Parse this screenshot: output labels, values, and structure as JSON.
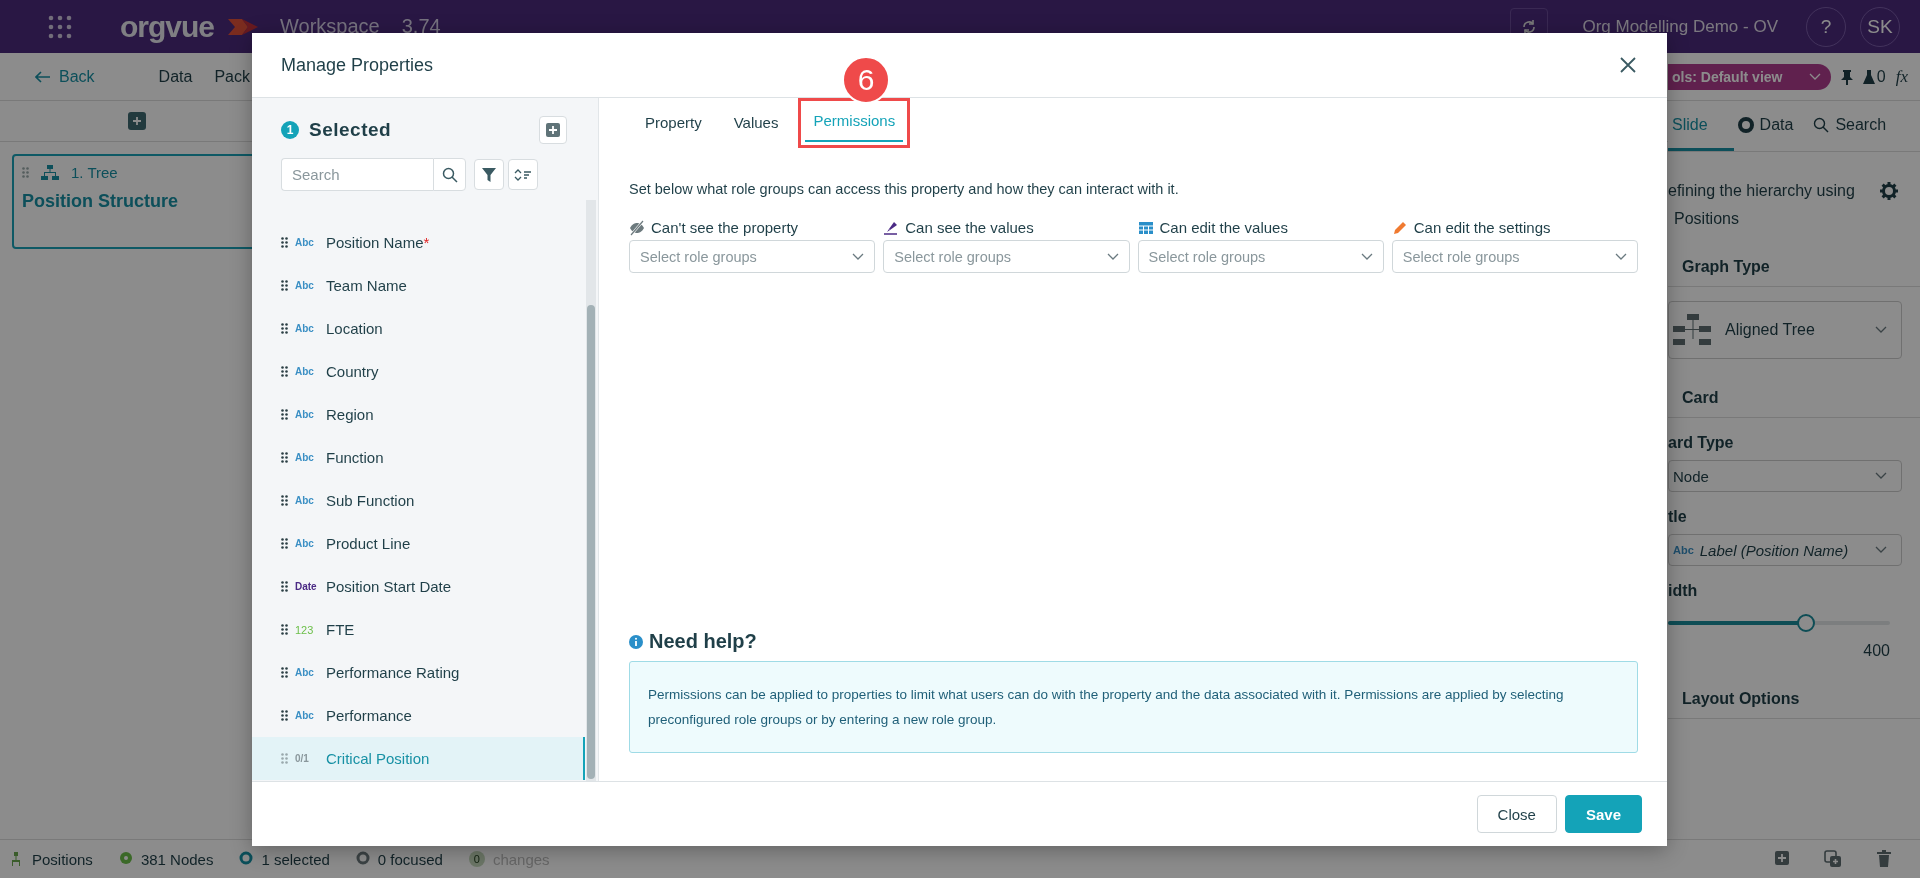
{
  "top_bar": {
    "app_name": "orgvue",
    "workspace": "Workspace",
    "version": "3.74",
    "project": "Org Modelling Demo - OV",
    "help": "?",
    "user_initials": "SK"
  },
  "toolbar": {
    "back": "Back",
    "menu": [
      "Data",
      "Pack"
    ],
    "view_pill": "ols: Default view",
    "flask_count": "0",
    "formula": "fx"
  },
  "canvas": {
    "card": {
      "kind_label": "1. Tree",
      "title": "Position Structure"
    }
  },
  "side_panel": {
    "tabs": [
      {
        "label": "Slide",
        "selected": true,
        "kind": "slide"
      },
      {
        "label": "Data",
        "selected": false,
        "kind": "data"
      },
      {
        "label": "Search",
        "selected": false,
        "kind": "search"
      }
    ],
    "description": "efining the hierarchy using",
    "hierarchy": "Positions",
    "graph_type_heading": "Graph Type",
    "graph_type": "Aligned Tree",
    "card_heading": "Card",
    "card_type_label": "ard Type",
    "card_type": "Node",
    "title_label": "tle",
    "title_tag": "Abc",
    "title_value": "Label (Position Name)",
    "width_label": "idth",
    "width_slider": {
      "level": 0.62
    },
    "width_max": "400",
    "layout_heading": "Layout Options"
  },
  "status_bar": {
    "items": [
      {
        "kind": "hierarchy",
        "label": "Positions",
        "disabled": false
      },
      {
        "kind": "nodes",
        "label": "381 Nodes",
        "disabled": false
      },
      {
        "kind": "selected",
        "label": "1 selected",
        "disabled": false
      },
      {
        "kind": "focused",
        "label": "0 focused",
        "disabled": false
      },
      {
        "kind": "changes",
        "label": "changes",
        "badge": "0",
        "disabled": true
      }
    ]
  },
  "dialog": {
    "title": "Manage Properties",
    "required_marker": "*",
    "selected_count": "1",
    "selected_label": "Selected",
    "search": {
      "placeholder": "Search"
    },
    "properties": [
      {
        "kind": "text",
        "tag": "Abc",
        "name": "Position Name",
        "required": true,
        "selected": false
      },
      {
        "kind": "text",
        "tag": "Abc",
        "name": "Team Name",
        "required": false,
        "selected": false
      },
      {
        "kind": "text",
        "tag": "Abc",
        "name": "Location",
        "required": false,
        "selected": false
      },
      {
        "kind": "text",
        "tag": "Abc",
        "name": "Country",
        "required": false,
        "selected": false
      },
      {
        "kind": "text",
        "tag": "Abc",
        "name": "Region",
        "required": false,
        "selected": false
      },
      {
        "kind": "text",
        "tag": "Abc",
        "name": "Function",
        "required": false,
        "selected": false
      },
      {
        "kind": "text",
        "tag": "Abc",
        "name": "Sub Function",
        "required": false,
        "selected": false
      },
      {
        "kind": "text",
        "tag": "Abc",
        "name": "Product Line",
        "required": false,
        "selected": false
      },
      {
        "kind": "date",
        "tag": "Date",
        "name": "Position Start Date",
        "required": false,
        "selected": false
      },
      {
        "kind": "number",
        "tag": "123",
        "name": "FTE",
        "required": false,
        "selected": false
      },
      {
        "kind": "text",
        "tag": "Abc",
        "name": "Performance Rating",
        "required": false,
        "selected": false
      },
      {
        "kind": "text",
        "tag": "Abc",
        "name": "Performance",
        "required": false,
        "selected": false
      },
      {
        "kind": "boolean",
        "tag": "0/1",
        "name": "Critical Position",
        "required": false,
        "selected": true
      }
    ],
    "tabs": [
      {
        "label": "Property",
        "selected": false
      },
      {
        "label": "Values",
        "selected": false
      },
      {
        "label": "Permissions",
        "selected": true
      }
    ],
    "instructions": "Set below what role groups can access this property and how they can interact with it.",
    "permissions": [
      {
        "kind": "hidden",
        "label": "Can't see the property",
        "placeholder": "Select role groups"
      },
      {
        "kind": "view",
        "label": "Can see the values",
        "placeholder": "Select role groups"
      },
      {
        "kind": "edit_values",
        "label": "Can edit the values",
        "placeholder": "Select role groups"
      },
      {
        "kind": "edit_settings",
        "label": "Can edit the settings",
        "placeholder": "Select role groups"
      }
    ],
    "help_title": "Need help?",
    "help_text": "Permissions can be applied to properties to limit what users can do with the property and the data associated with it. Permissions are applied by selecting preconfigured role groups or by entering a new role group.",
    "buttons": [
      {
        "kind": "secondary",
        "label": "Close"
      },
      {
        "kind": "primary",
        "label": "Save"
      }
    ]
  },
  "annotation": {
    "number": "6"
  }
}
